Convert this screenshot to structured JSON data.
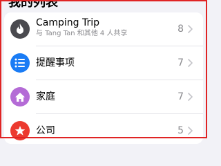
{
  "title": "我的列表",
  "colors": {
    "camping": "#4a4a4f",
    "reminders": "#1a7cf5",
    "family": "#b46bd6",
    "company": "#ec3a2f",
    "frame": "#e02424"
  },
  "lists": [
    {
      "name": "Camping Trip",
      "subtitle": "与 Tang Tan 和其他 4 人共享",
      "count": "8",
      "icon": "flame-icon"
    },
    {
      "name": "提醒事项",
      "count": "7",
      "icon": "list-bullet-icon"
    },
    {
      "name": "家庭",
      "count": "7",
      "icon": "house-icon"
    },
    {
      "name": "公司",
      "count": "5",
      "icon": "star-icon"
    }
  ]
}
